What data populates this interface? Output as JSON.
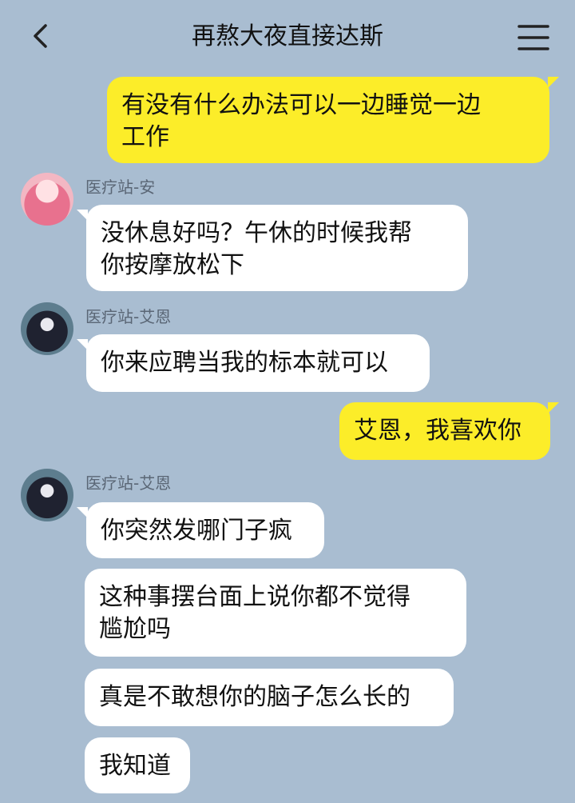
{
  "header": {
    "title": "再熬大夜直接达斯",
    "back_icon": "chevron-left-icon",
    "menu_icon": "hamburger-menu-icon"
  },
  "colors": {
    "background": "#a9bdd1",
    "self_bubble": "#fced29",
    "other_bubble": "#ffffff"
  },
  "messages": [
    {
      "from": "self",
      "text": "有没有什么办法可以一边睡觉一边\n工作"
    },
    {
      "from": "医疗站-安",
      "text": "没休息好吗？午休的时候我帮\n你按摩放松下"
    },
    {
      "from": "医疗站-艾恩",
      "text": "你来应聘当我的标本就可以"
    },
    {
      "from": "self",
      "text": "艾恩，我喜欢你"
    },
    {
      "from": "医疗站-艾恩",
      "text": "你突然发哪门子疯"
    },
    {
      "from": "医疗站-艾恩",
      "text": "这种事摆台面上说你都不觉得\n尴尬吗"
    },
    {
      "from": "医疗站-艾恩",
      "text": "真是不敢想你的脑子怎么长的"
    },
    {
      "from": "医疗站-艾恩",
      "text": "我知道"
    }
  ],
  "senders": {
    "an": "医疗站-安",
    "ai1": "医疗站-艾恩",
    "ai2": "医疗站-艾恩"
  }
}
